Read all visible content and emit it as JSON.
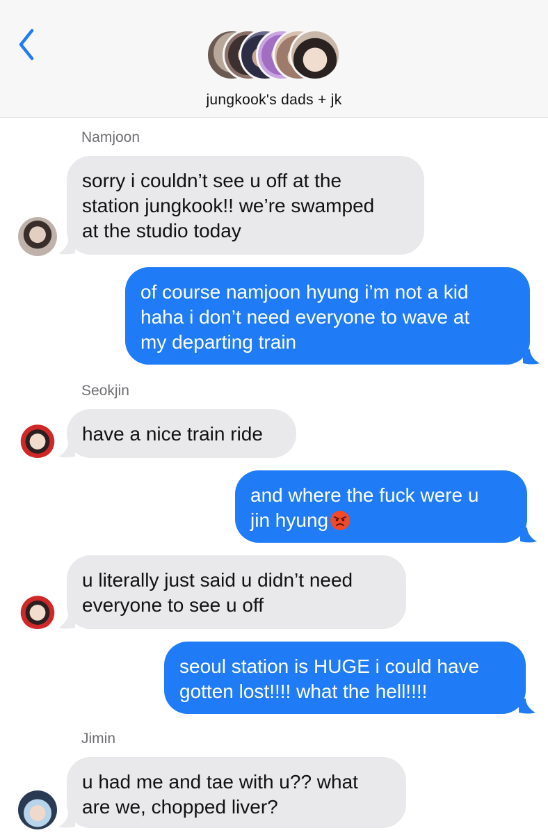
{
  "header": {
    "title": "jungkook's dads + jk",
    "back_icon": "chevron-left-icon",
    "accent_color": "#1f7bf6"
  },
  "messages": [
    {
      "direction": "incoming",
      "sender": "Namjoon",
      "lines": [
        "sorry i couldn’t see u off at the",
        "station jungkook!! we’re swamped",
        "at the studio today"
      ]
    },
    {
      "direction": "outgoing",
      "lines": [
        "of course namjoon hyung i’m not a kid",
        "haha i don’t need everyone to wave at",
        "my departing train"
      ]
    },
    {
      "direction": "incoming",
      "sender": "Seokjin",
      "lines": [
        "have a nice train ride"
      ]
    },
    {
      "direction": "outgoing",
      "lines": [
        "and where the fuck were u",
        "jin hyung"
      ],
      "emoji": "angry-face-emoji"
    },
    {
      "direction": "incoming",
      "lines": [
        "u literally just said u didn’t need",
        "everyone to see u off"
      ]
    },
    {
      "direction": "outgoing",
      "lines": [
        "seoul station is HUGE i could have",
        "gotten lost!!!! what the hell!!!!"
      ]
    },
    {
      "direction": "incoming",
      "sender": "Jimin",
      "lines": [
        "u had me and tae with u?? what",
        "are we, chopped liver?"
      ]
    }
  ],
  "colors": {
    "incoming_bubble": "#e9e9eb",
    "outgoing_bubble": "#1f7bf6",
    "header_bg": "#f7f7f7",
    "sender_name": "#6e6e73"
  }
}
